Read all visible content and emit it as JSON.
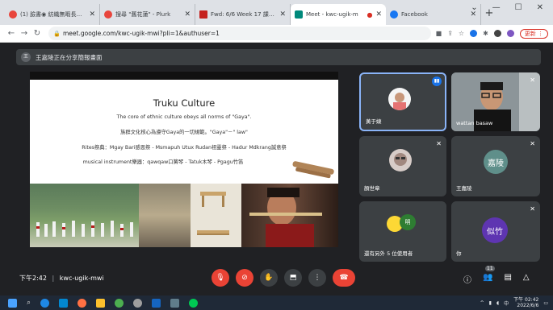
{
  "browser": {
    "tabs": [
      {
        "title": "(1) 臉書◉ 紡織無暇長蛇...",
        "color": "#e8453c",
        "active": false
      },
      {
        "title": "搜尋 \"舊花蓮\" - Plurk",
        "color": "#e8453c",
        "active": false
      },
      {
        "title": "Fwd: 6/6 Week 17 課程...",
        "color": "#c5221f",
        "active": false
      },
      {
        "title": "Meet - kwc-ugik-m",
        "color": "#00897b",
        "active": true
      },
      {
        "title": "Facebook",
        "color": "#1877f2",
        "active": false
      }
    ],
    "new_tab": "+",
    "url": "meet.google.com/kwc-ugik-mwi?pli=1&authuser=1",
    "update_label": "更新 ⋮"
  },
  "meet": {
    "banner_avatar": "王",
    "banner_text": "王嘉陵正在分享簡報畫面",
    "slide": {
      "title": "Truku Culture",
      "lines": [
        "The core of ethnic culture obeys all norms of \"Gaya\".",
        "族群文化核心為遵守Gaya的一切規範。\"Gaya\"－\" law\"",
        "Rites祭典：Mgay Bari感恩祭 - Msmapuh Utux Rudan祖靈祭 - Hadur Mdkrang誠意祭",
        "musical instrument樂器：qawqaw口簧琴 - Tatuk木琴 - Pgagu竹笛"
      ]
    },
    "participants": [
      {
        "name": "黃于婕"
      },
      {
        "name": "wattan basaw"
      },
      {
        "name": "顏世章"
      },
      {
        "name": "王嘉陵",
        "initials": "嘉陵",
        "color": "#5f8f8a"
      },
      {
        "name": "還有另外 5 位使用者",
        "initials": "明",
        "color": "#2e7d32"
      },
      {
        "name": "你",
        "initials": "似竹",
        "color": "#5e35b1"
      }
    ],
    "time": "下午2:42",
    "separator": "|",
    "meeting_code": "kwc-ugik-mwi",
    "people_count": "11"
  },
  "taskbar": {
    "clock_time": "下午 02:42",
    "clock_date": "2022/6/6"
  }
}
